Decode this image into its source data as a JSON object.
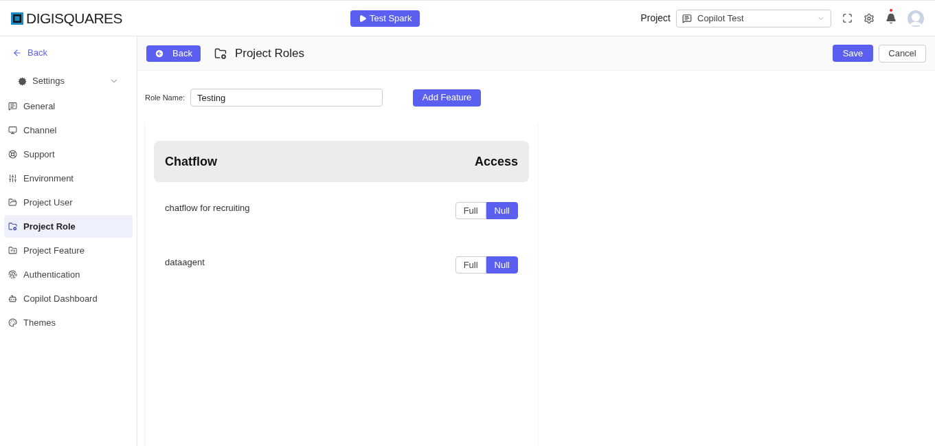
{
  "header": {
    "logo": "DIGISQUARES",
    "test_button": "Test Spark",
    "project_label": "Project",
    "project_select": {
      "value": "Copilot Test"
    },
    "notification_dot": true
  },
  "sidebar": {
    "back": "Back",
    "settings": {
      "label": "Settings",
      "expanded": true
    },
    "items": [
      {
        "label": "General",
        "selected": false
      },
      {
        "label": "Channel",
        "selected": false
      },
      {
        "label": "Support",
        "selected": false
      },
      {
        "label": "Environment",
        "selected": false
      },
      {
        "label": "Project User",
        "selected": false
      },
      {
        "label": "Project Role",
        "selected": true
      },
      {
        "label": "Project Feature",
        "selected": false
      },
      {
        "label": "Authentication",
        "selected": false
      },
      {
        "label": "Copilot Dashboard",
        "selected": false
      },
      {
        "label": "Themes",
        "selected": false
      }
    ]
  },
  "toolbar": {
    "back": "Back",
    "title": "Project Roles",
    "save": "Save",
    "cancel": "Cancel"
  },
  "form": {
    "role_label": "Role Name:",
    "role_value": "Testing",
    "add_feature": "Add Feature"
  },
  "table": {
    "columns": [
      "Chatflow",
      "Access"
    ],
    "rows": [
      {
        "name": "chatflow for recruiting",
        "options": [
          {
            "label": "Full",
            "selected": false
          },
          {
            "label": "Null",
            "selected": true
          }
        ]
      },
      {
        "name": "dataagent",
        "options": [
          {
            "label": "Full",
            "selected": false
          },
          {
            "label": "Null",
            "selected": true
          }
        ]
      }
    ]
  }
}
